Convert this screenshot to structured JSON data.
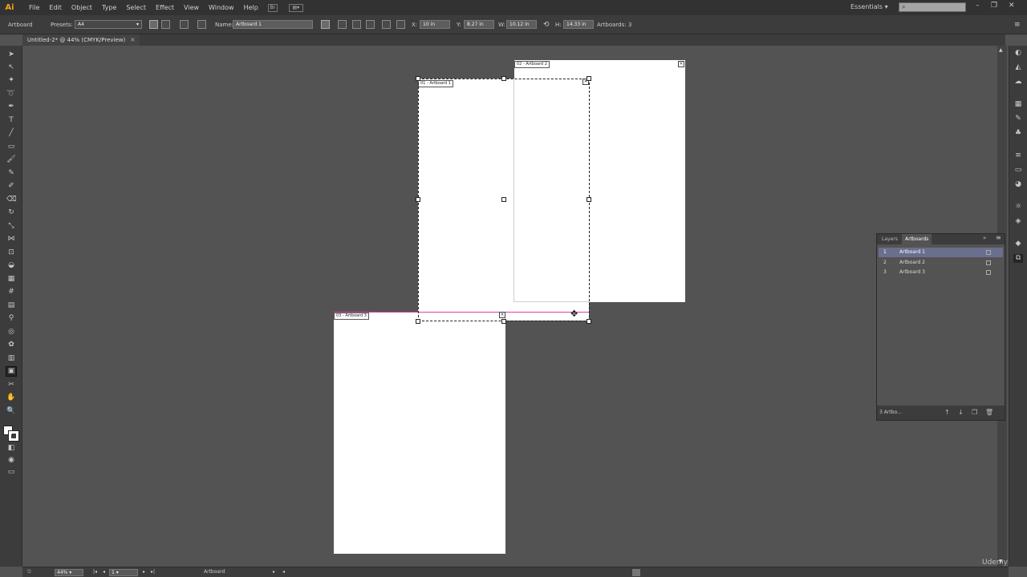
{
  "app": {
    "logo": "Ai"
  },
  "menubar": {
    "items": [
      "File",
      "Edit",
      "Object",
      "Type",
      "Select",
      "Effect",
      "View",
      "Window",
      "Help"
    ],
    "bridge_label": "Br",
    "workspace": "Essentials",
    "search_placeholder": ""
  },
  "controlbar": {
    "tool_label": "Artboard",
    "presets_label": "Presets:",
    "presets_value": "A4",
    "name_label": "Name:",
    "name_value": "Artboard 1",
    "x_label": "X:",
    "x_value": "10 in",
    "y_label": "Y:",
    "y_value": "8.27 in",
    "w_label": "W:",
    "w_value": "10.12 in",
    "h_label": "H:",
    "h_value": "14.33 in",
    "artboards_label": "Artboards:",
    "artboards_count": "3"
  },
  "document": {
    "tab_title": "Untitled-2* @ 44% (CMYK/Preview)",
    "close": "×"
  },
  "artboards": [
    {
      "label": "01 - Artboard 1"
    },
    {
      "label": "02 - Artboard 2"
    },
    {
      "label": "03 - Artboard 3"
    }
  ],
  "panel": {
    "tabs": [
      "Layers",
      "Artboards"
    ],
    "active_tab": "Artboards",
    "rows": [
      {
        "num": "1",
        "name": "Artboard 1",
        "selected": true
      },
      {
        "num": "2",
        "name": "Artboard 2",
        "selected": false
      },
      {
        "num": "3",
        "name": "Artboard 3",
        "selected": false
      }
    ],
    "footer_label": "3 Artbo..."
  },
  "statusbar": {
    "zoom": "44%",
    "page": "1",
    "tool_status": "Artboard"
  },
  "watermark": "Udemy"
}
